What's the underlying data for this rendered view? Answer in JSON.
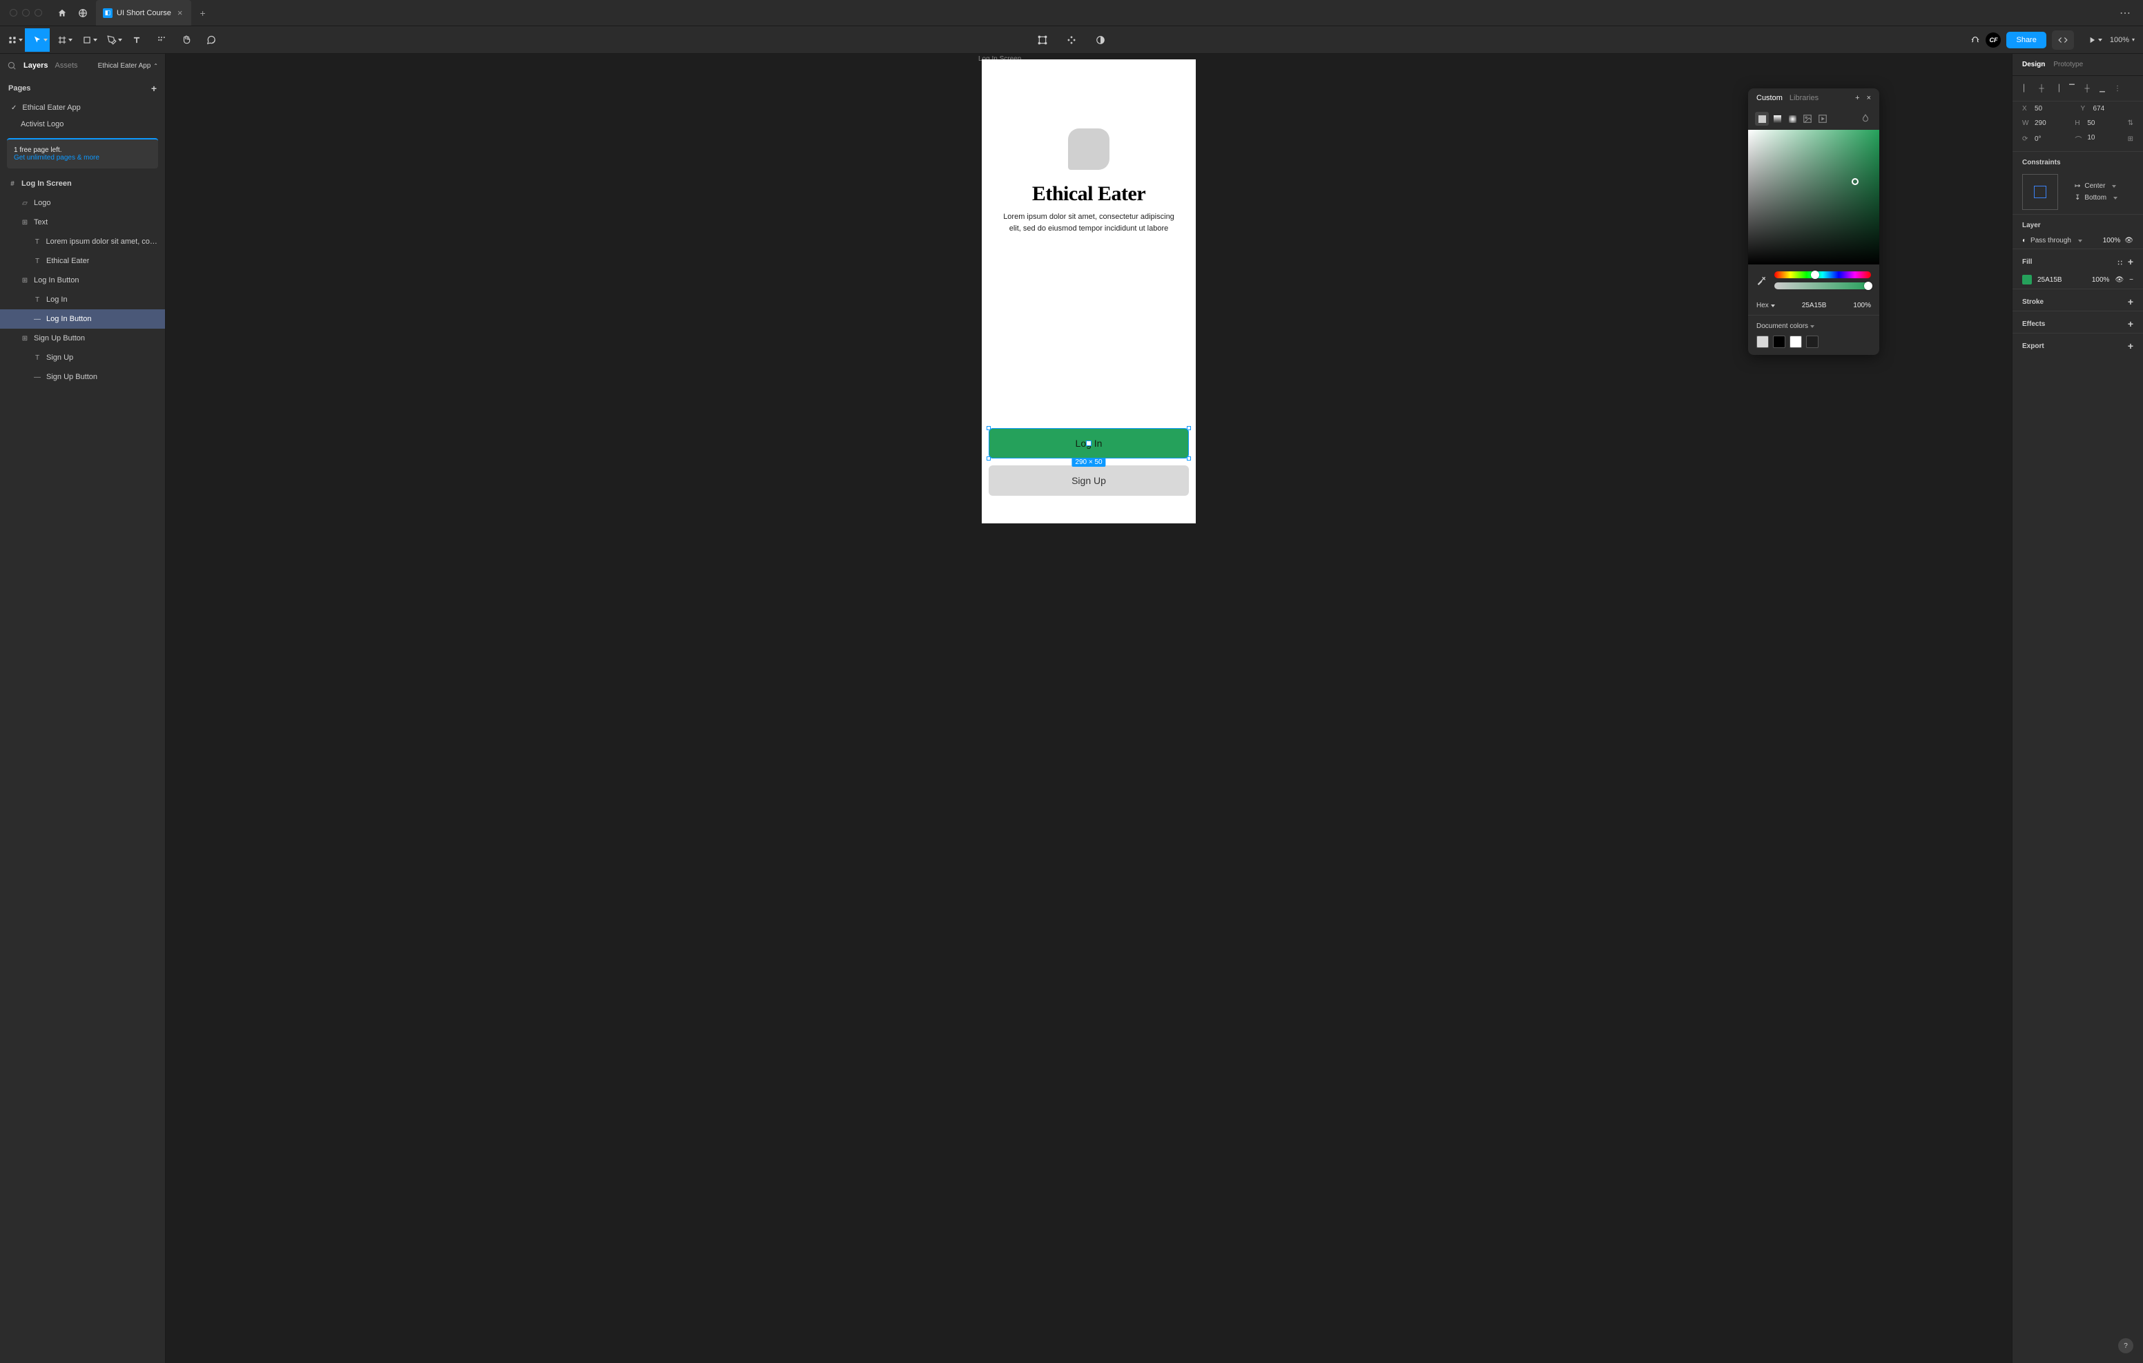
{
  "tab": {
    "title": "UI Short Course"
  },
  "toolbar": {
    "zoom": "100%",
    "share": "Share"
  },
  "leftPanel": {
    "layers": "Layers",
    "assets": "Assets",
    "crumb": "Ethical Eater App",
    "pages": "Pages",
    "pageList": [
      "Ethical Eater App",
      "Activist Logo"
    ],
    "promo1": "1 free page left.",
    "promo2": "Get unlimited pages & more",
    "layerRows": [
      {
        "indent": 12,
        "icon": "#",
        "label": "Log In Screen",
        "bold": true,
        "sel": false
      },
      {
        "indent": 30,
        "icon": "▱",
        "label": "Logo",
        "bold": false,
        "sel": false
      },
      {
        "indent": 30,
        "icon": "⊞",
        "label": "Text",
        "bold": false,
        "sel": false
      },
      {
        "indent": 48,
        "icon": "T",
        "label": "Lorem ipsum dolor sit amet, cons...",
        "bold": false,
        "sel": false
      },
      {
        "indent": 48,
        "icon": "T",
        "label": "Ethical Eater",
        "bold": false,
        "sel": false
      },
      {
        "indent": 30,
        "icon": "⊞",
        "label": "Log In Button",
        "bold": false,
        "sel": false
      },
      {
        "indent": 48,
        "icon": "T",
        "label": "Log In",
        "bold": false,
        "sel": false
      },
      {
        "indent": 48,
        "icon": "—",
        "label": "Log In Button",
        "bold": false,
        "sel": true
      },
      {
        "indent": 30,
        "icon": "⊞",
        "label": "Sign Up Button",
        "bold": false,
        "sel": false
      },
      {
        "indent": 48,
        "icon": "T",
        "label": "Sign Up",
        "bold": false,
        "sel": false
      },
      {
        "indent": 48,
        "icon": "—",
        "label": "Sign Up Button",
        "bold": false,
        "sel": false
      }
    ]
  },
  "canvas": {
    "frameLabel": "Log In Screen",
    "appTitle": "Ethical Eater",
    "lorem": "Lorem ipsum dolor sit amet, consectetur adipiscing elit, sed do eiusmod tempor incididunt ut labore",
    "loginLabel": "Log In",
    "signupLabel": "Sign Up",
    "dimLabel": "290 × 50"
  },
  "colorPicker": {
    "custom": "Custom",
    "libraries": "Libraries",
    "hexLabel": "Hex",
    "hex": "25A15B",
    "opacity": "100%",
    "docColors": "Document colors",
    "swatches": [
      "#d9d9d9",
      "#000000",
      "#ffffff",
      "#1e1e1e"
    ]
  },
  "rightPanel": {
    "design": "Design",
    "prototype": "Prototype",
    "x": "50",
    "y": "674",
    "w": "290",
    "h": "50",
    "rotation": "0°",
    "radius": "10",
    "constraints": "Constraints",
    "constraintH": "Center",
    "constraintV": "Bottom",
    "layerSection": "Layer",
    "passThrough": "Pass through",
    "layerOpacity": "100%",
    "fillSection": "Fill",
    "fillHex": "25A15B",
    "fillOpacity": "100%",
    "stroke": "Stroke",
    "effects": "Effects",
    "export": "Export"
  }
}
